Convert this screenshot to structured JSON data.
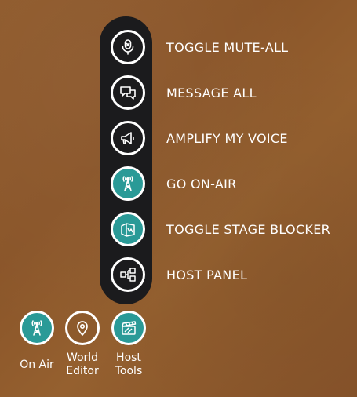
{
  "menu": {
    "items": [
      {
        "label": "TOGGLE MUTE-ALL",
        "icon": "microphone-icon"
      },
      {
        "label": "MESSAGE ALL",
        "icon": "chat-bubbles-icon"
      },
      {
        "label": "AMPLIFY MY VOICE",
        "icon": "megaphone-icon"
      },
      {
        "label": "GO ON-AIR",
        "icon": "broadcast-tower-icon"
      },
      {
        "label": "TOGGLE STAGE BLOCKER",
        "icon": "stage-blocker-icon"
      },
      {
        "label": "HOST PANEL",
        "icon": "host-panel-icon"
      }
    ]
  },
  "toolbar": {
    "on_air": "On Air",
    "world_editor_line1": "World",
    "world_editor_line2": "Editor",
    "host_tools_line1": "Host",
    "host_tools_line2": "Tools"
  },
  "colors": {
    "background": "#8f5a2c",
    "panel": "#1b1b1d",
    "accent_teal": "#2a9a97",
    "text": "#ffffff"
  }
}
